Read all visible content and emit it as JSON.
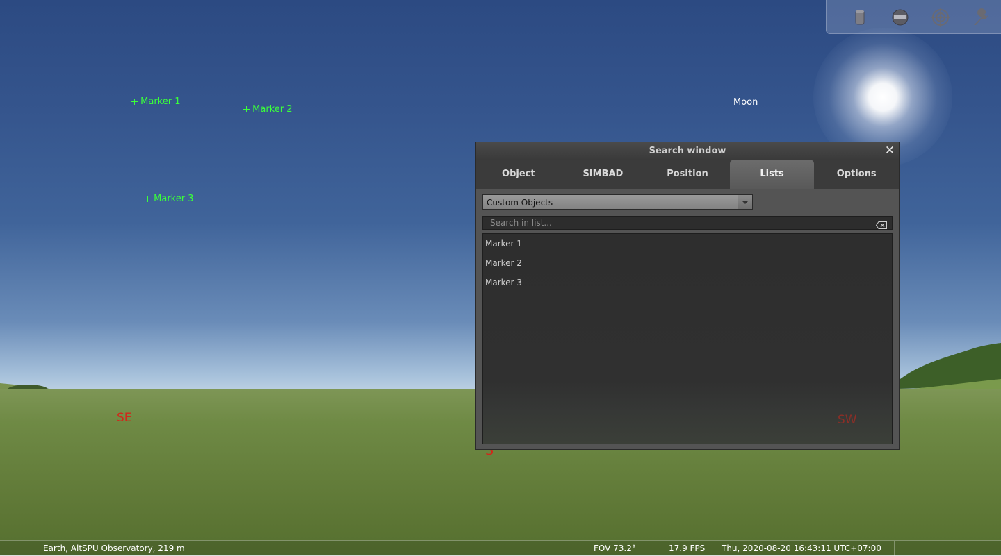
{
  "sky": {
    "markers": [
      {
        "label": "Marker 1"
      },
      {
        "label": "Marker 2"
      },
      {
        "label": "Marker 3"
      }
    ],
    "moon_label": "Moon",
    "cardinals": {
      "se": "SE",
      "s": "S",
      "sw": "SW"
    }
  },
  "toolbar": {
    "icons": [
      "telescope-icon",
      "ocular-view-icon",
      "target-icon",
      "wrench-icon"
    ]
  },
  "search_window": {
    "title": "Search window",
    "tabs": [
      {
        "label": "Object"
      },
      {
        "label": "SIMBAD"
      },
      {
        "label": "Position"
      },
      {
        "label": "Lists",
        "active": true
      },
      {
        "label": "Options"
      }
    ],
    "list_select": {
      "value": "Custom Objects"
    },
    "search_input": {
      "placeholder": "Search in list..."
    },
    "objects": [
      "Marker 1",
      "Marker 2",
      "Marker 3"
    ]
  },
  "statusbar": {
    "location": "Earth, AltSPU Observatory, 219 m",
    "fov": "FOV 73.2°",
    "fps": "17.9 FPS",
    "datetime": "Thu, 2020-08-20 16:43:11 UTC+07:00"
  },
  "colors": {
    "marker": "#3aff3a",
    "cardinal": "#d2261a",
    "active_tab": "#6c6c6c"
  }
}
